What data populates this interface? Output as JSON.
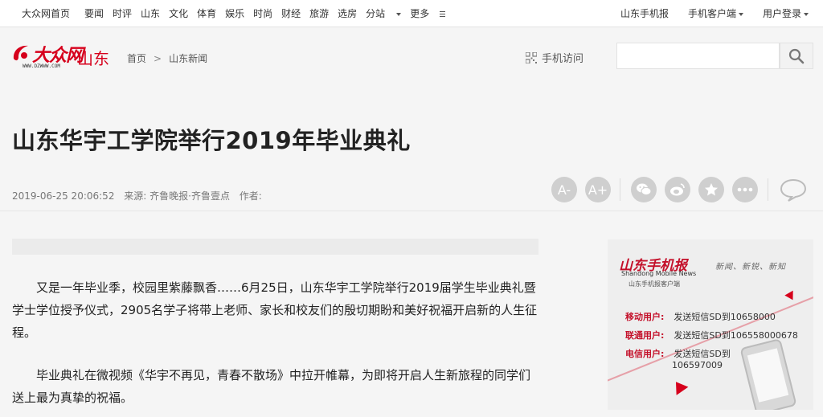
{
  "topnav": {
    "home": "大众网首页",
    "items": [
      "要闻",
      "时评",
      "山东",
      "文化",
      "体育",
      "娱乐",
      "时尚",
      "财经",
      "旅游",
      "选房",
      "分站",
      "更多"
    ],
    "right": [
      "山东手机报",
      "手机客户端",
      "用户登录"
    ]
  },
  "header": {
    "logo_brand": "大众网",
    "logo_region": "山东",
    "logo_url": "WWW.DZWWW.COM",
    "breadcrumb": [
      "首页",
      "山东新闻"
    ],
    "breadcrumb_sep": ">",
    "mobile_link": "手机访问",
    "search_placeholder": ""
  },
  "article": {
    "title": "山东华宇工学院举行2019年毕业典礼",
    "date": "2019-06-25 20:06:52",
    "source": "来源: 齐鲁晚报·齐鲁壹点",
    "author": "作者:",
    "paragraphs": [
      "又是一年毕业季，校园里紫藤飘香……6月25日，山东华宇工学院举行2019届学生毕业典礼暨学士学位授予仪式，2905名学子将带上老师、家长和校友们的殷切期盼和美好祝福开启新的人生征程。",
      "毕业典礼在微视频《华宇不再见，青春不散场》中拉开帷幕，为即将开启人生新旅程的同学们送上最为真挚的祝福。"
    ]
  },
  "tools": {
    "font_decrease": "A-",
    "font_increase": "A+",
    "icons": [
      "wechat-icon",
      "weibo-icon",
      "favorite-icon",
      "more-icon",
      "comment-icon"
    ]
  },
  "ad": {
    "title": "山东手机报",
    "slogan": "新闻、新锐、新知",
    "english": "Shandong Mobile News",
    "subtitle": "山东手机报客户端",
    "rows": [
      {
        "key": "移动用户:",
        "value": "发送短信SD到10658000"
      },
      {
        "key": "联通用户:",
        "value": "发送短信SD到106558000678"
      },
      {
        "key": "电信用户:",
        "value": "发送短信SD到"
      },
      {
        "key": "",
        "value": "106597009"
      }
    ]
  },
  "colors": {
    "brand_red": "#d6001c",
    "tool_grey": "#cfcfcf",
    "page_bg": "#f5f5f5"
  }
}
